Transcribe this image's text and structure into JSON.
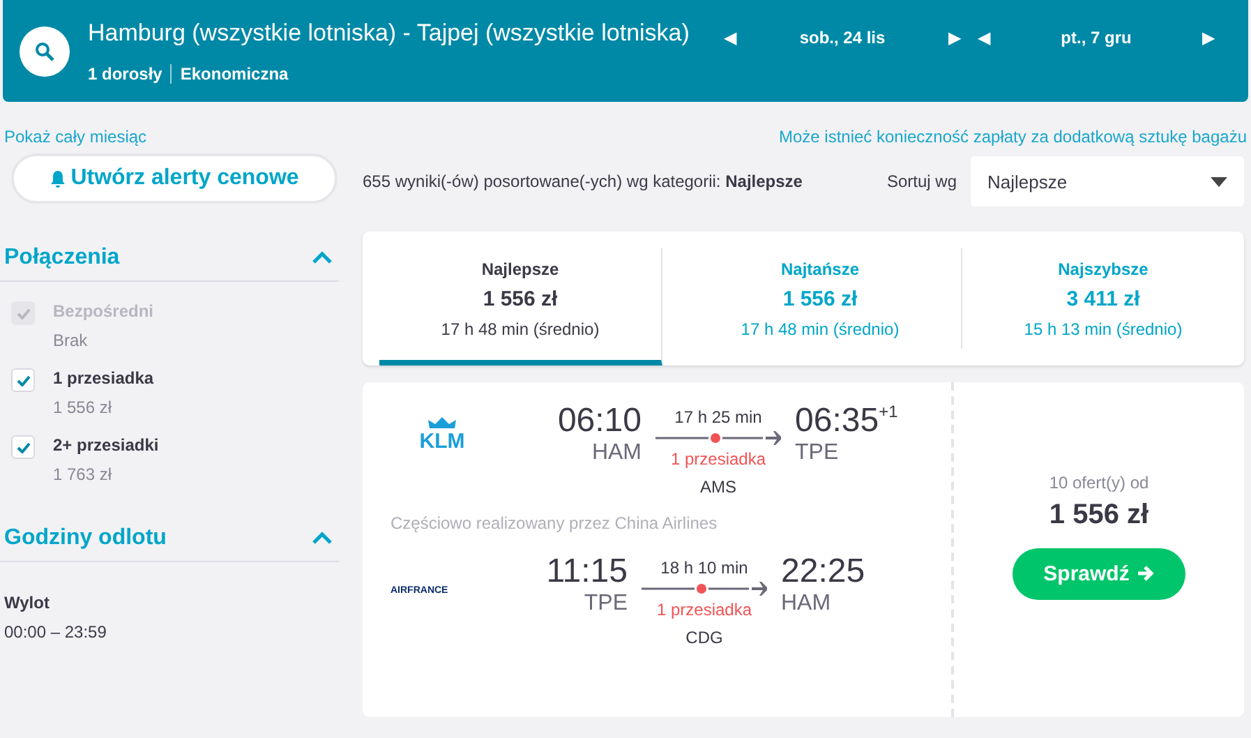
{
  "search": {
    "route": "Hamburg (wszystkie lotniska) - Tajpej (wszystkie lotniska)",
    "passengers": "1 dorosły",
    "cabin": "Ekonomiczna",
    "dates": [
      {
        "prev": "◀",
        "label": "sob., 24 lis",
        "next": "▶"
      },
      {
        "prev": "◀",
        "label": "pt., 7 gru",
        "next": "▶"
      }
    ]
  },
  "links": {
    "month": "Pokaż cały miesiąc",
    "baggage": "Może istnieć konieczność zapłaty za dodatkową sztukę bagażu"
  },
  "alert_button": "Utwórz alerty cenowe",
  "filters": [
    {
      "title": "Połączenia",
      "expanded": true,
      "kind": "checks",
      "options": [
        {
          "label": "Bezpośredni",
          "price": "Brak",
          "checked": true,
          "disabled": true
        },
        {
          "label": "1 przesiadka",
          "price": "1 556 zł",
          "checked": true,
          "disabled": false
        },
        {
          "label": "2+ przesiadki",
          "price": "1 763 zł",
          "checked": true,
          "disabled": false
        }
      ]
    },
    {
      "title": "Godziny odlotu",
      "expanded": true,
      "kind": "times",
      "label": "Wylot",
      "range": "00:00 – 23:59"
    }
  ],
  "results": {
    "summary": "655 wyniki(-ów) posortowane(-ych) wg kategorii: **Najlepsze**",
    "sort_label": "Sortuj wg",
    "sort_value": "Najlepsze"
  },
  "tabs": [
    {
      "label": "Najlepsze",
      "price": "1 556 zł",
      "duration": "17 h 48 min (średnio)",
      "selected": true
    },
    {
      "label": "Najtańsze",
      "price": "1 556 zł",
      "duration": "17 h 48 min (średnio)",
      "selected": false
    },
    {
      "label": "Najszybsze",
      "price": "3 411 zł",
      "duration": "15 h 13 min (średnio)",
      "selected": false
    }
  ],
  "flight": {
    "legs": [
      {
        "logo": "KLM",
        "dep_time": "06:10",
        "dep_code": "HAM",
        "duration": "17 h 25 min",
        "stops": "1 przesiadka",
        "via": "AMS",
        "arr_time": "06:35",
        "day_offset": "+1",
        "arr_code": "TPE"
      },
      {
        "note": "Częściowo realizowany przez China Airlines",
        "logo": "AIRFRANCE",
        "dep_time": "11:15",
        "dep_code": "TPE",
        "duration": "18 h 10 min",
        "stops": "1 przesiadka",
        "via": "CDG",
        "arr_time": "22:25",
        "arr_code": "HAM"
      }
    ],
    "offers": "10 ofert(y) od",
    "price": "1 556 zł",
    "button": "Sprawdź"
  }
}
